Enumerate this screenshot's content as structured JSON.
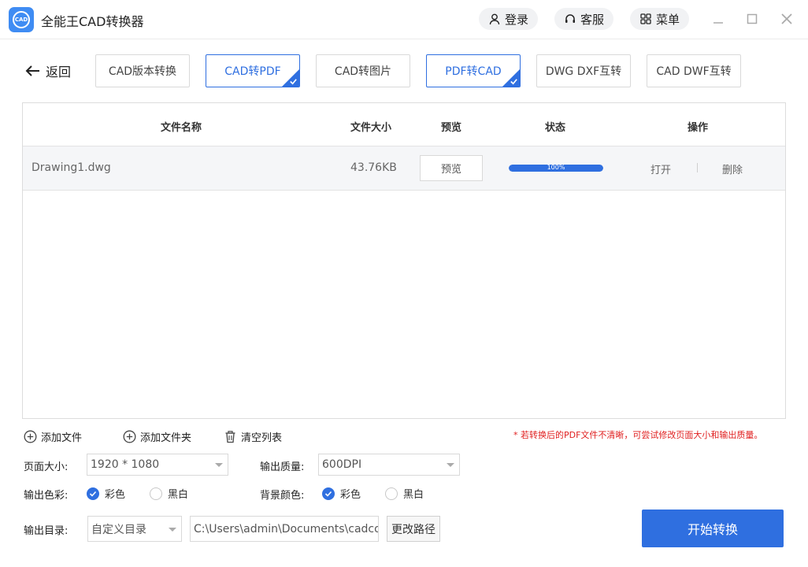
{
  "app": {
    "logo_text": "CAD",
    "title": "全能王CAD转换器"
  },
  "header": {
    "login": "登录",
    "service": "客服",
    "menu": "菜单"
  },
  "nav": {
    "back": "返回"
  },
  "tabs": [
    {
      "label": "CAD版本转换",
      "active": false
    },
    {
      "label": "CAD转PDF",
      "active": true
    },
    {
      "label": "CAD转图片",
      "active": false
    },
    {
      "label": "PDF转CAD",
      "active": true
    },
    {
      "label": "DWG DXF互转",
      "active": false
    },
    {
      "label": "CAD DWF互转",
      "active": false
    }
  ],
  "table": {
    "headers": {
      "name": "文件名称",
      "size": "文件大小",
      "preview": "预览",
      "status": "状态",
      "actions": "操作"
    },
    "rows": [
      {
        "name": "Drawing1.dwg",
        "size": "43.76KB",
        "preview": "预览",
        "progress_text": "100%",
        "progress": 1.0,
        "open": "打开",
        "delete": "删除"
      }
    ]
  },
  "actions": {
    "add_file": "添加文件",
    "add_folder": "添加文件夹",
    "clear_list": "清空列表"
  },
  "hint": "* 若转换后的PDF文件不清晰，可尝试修改页面大小和输出质量。",
  "settings": {
    "page_size_label": "页面大小:",
    "page_size_value": "1920 * 1080",
    "quality_label": "输出质量:",
    "quality_value": "600DPI",
    "color_label": "输出色彩:",
    "color_option_color": "彩色",
    "color_option_bw": "黑白",
    "bg_label": "背景颜色:",
    "bg_option_color": "彩色",
    "bg_option_bw": "黑白",
    "output_dir_label": "输出目录:",
    "output_dir_mode": "自定义目录",
    "output_path": "C:\\Users\\admin\\Documents\\cadconverter",
    "change_path": "更改路径"
  },
  "start_button": "开始转换",
  "colors": {
    "accent": "#2f6fe0",
    "hint": "#e02020",
    "logo": "#3f8cf3"
  }
}
